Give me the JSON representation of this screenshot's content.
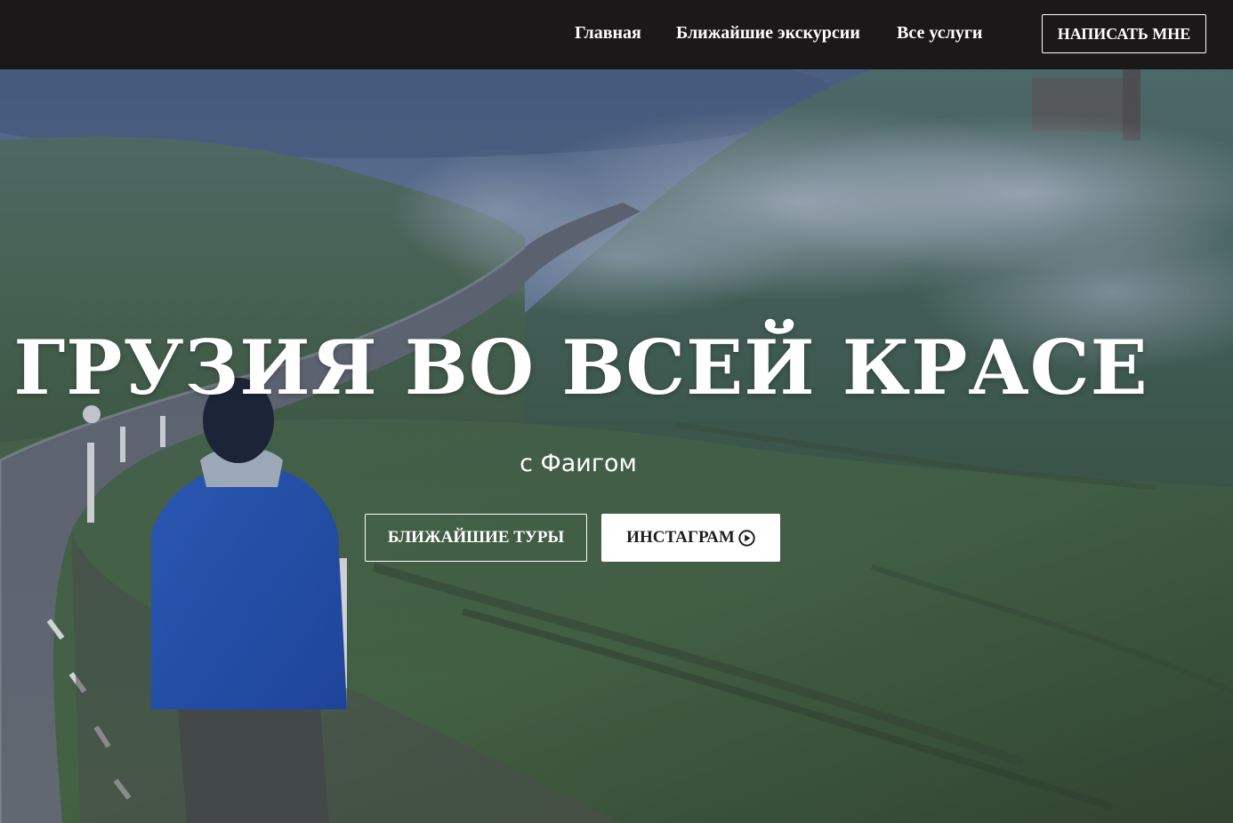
{
  "nav": {
    "links": [
      "Главная",
      "Ближайшие экскурсии",
      "Все услуги"
    ],
    "cta_label": "НАПИСАТЬ МНЕ"
  },
  "hero": {
    "title": "ГРУЗИЯ ВО ВСЕЙ КРАСЕ",
    "subtitle": "с Фаигом",
    "buttons": {
      "tours_label": "БЛИЖАЙШИЕ ТУРЫ",
      "instagram_label": "ИНСТАГРАМ",
      "instagram_icon": "play-circle-icon"
    },
    "background": "mountain-road-fog-photo"
  },
  "colors": {
    "nav_background": "#1a1819",
    "text": "#ffffff",
    "solid_button_background": "#ffffff",
    "solid_button_text": "#1f1f1f"
  }
}
